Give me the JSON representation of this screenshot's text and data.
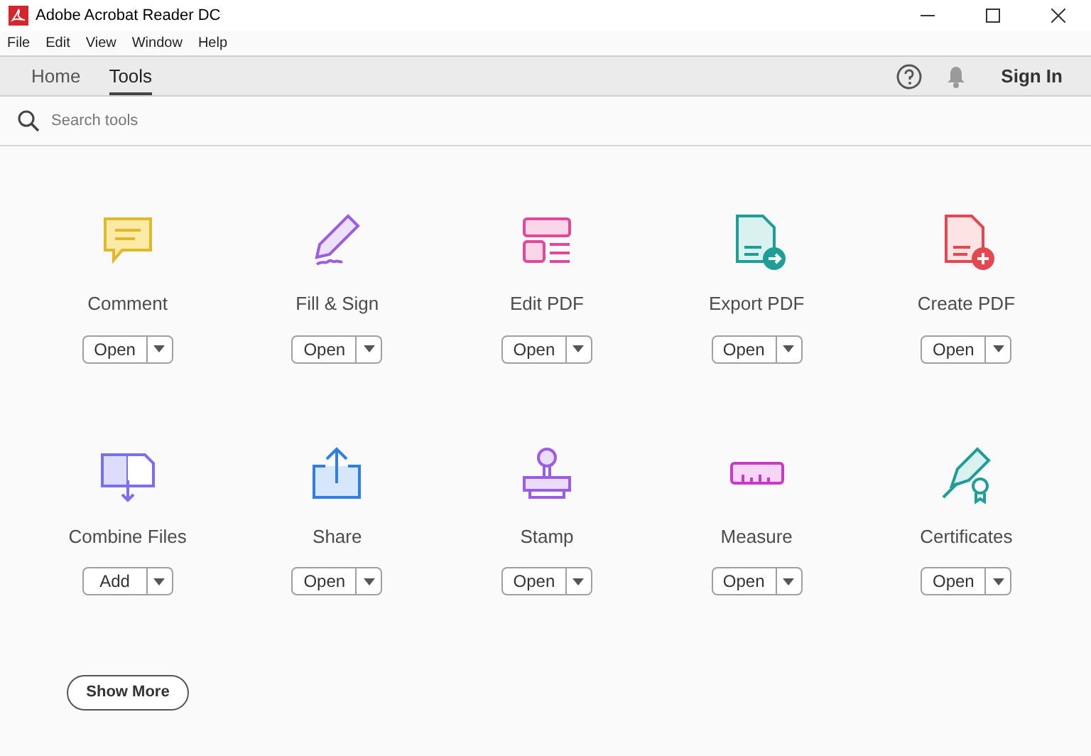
{
  "window": {
    "title": "Adobe Acrobat Reader DC"
  },
  "menu": [
    "File",
    "Edit",
    "View",
    "Window",
    "Help"
  ],
  "tabs": [
    {
      "label": "Home",
      "selected": false
    },
    {
      "label": "Tools",
      "selected": true
    }
  ],
  "sign_in": "Sign In",
  "search": {
    "placeholder": "Search tools"
  },
  "tools": [
    {
      "kind": "comment",
      "label": "Comment",
      "action": "Open"
    },
    {
      "kind": "fill-sign",
      "label": "Fill & Sign",
      "action": "Open"
    },
    {
      "kind": "edit",
      "label": "Edit PDF",
      "action": "Open"
    },
    {
      "kind": "export",
      "label": "Export PDF",
      "action": "Open"
    },
    {
      "kind": "create",
      "label": "Create PDF",
      "action": "Open"
    },
    {
      "kind": "combine",
      "label": "Combine Files",
      "action": "Add"
    },
    {
      "kind": "share",
      "label": "Share",
      "action": "Open"
    },
    {
      "kind": "stamp",
      "label": "Stamp",
      "action": "Open"
    },
    {
      "kind": "measure",
      "label": "Measure",
      "action": "Open"
    },
    {
      "kind": "certificate",
      "label": "Certificates",
      "action": "Open"
    }
  ],
  "show_more": "Show More"
}
